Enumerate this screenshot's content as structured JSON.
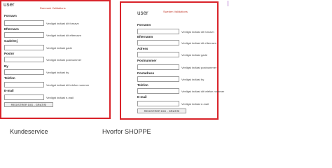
{
  "panels": {
    "dk": {
      "title": "user",
      "note": "Danmark Validations",
      "fields": [
        {
          "label": "Fornavn",
          "hint": "Venligst indtast dit fornavn"
        },
        {
          "label": "Efternavn",
          "hint": "Venligst indtast dit efternavn"
        },
        {
          "label": "Gade/Vej",
          "hint": "Venligst indtast gade"
        },
        {
          "label": "Postnr",
          "hint": "Venligst indtast postnummer"
        },
        {
          "label": "By",
          "hint": "Venligst indtast by"
        },
        {
          "label": "Telefon",
          "hint": "Venligst indtast dit telefon nummer"
        },
        {
          "label": "E-mail",
          "hint": "Venligst indtast e-mail"
        }
      ],
      "submit_label": "REGISTRER DIG - GRATIS!"
    },
    "se": {
      "title": "user",
      "note": "Sweden Validations",
      "fields": [
        {
          "label": "Fornamn",
          "hint": "Venligst indtast dit fornavn"
        },
        {
          "label": "Efternamn",
          "hint": "Venligst indtast dit efternavn"
        },
        {
          "label": "Adress",
          "hint": "Venligst indtast gade"
        },
        {
          "label": "Postnummer",
          "hint": "Venligst indtast postnummer"
        },
        {
          "label": "Postadress",
          "hint": "Venligst indtast by"
        },
        {
          "label": "Telefon",
          "hint": "Venligst indtast dit telefon nummer"
        },
        {
          "label": "E-mail",
          "hint": "Venligst indtast e-mail"
        }
      ],
      "submit_label": "REGISTRER DIG - GRATIS!"
    }
  },
  "footer": {
    "left_text": "Kundeservice",
    "right_text": "Hvorfor SHOPPE"
  },
  "colors": {
    "panel_border": "#d9232a",
    "note_text": "#c0392b"
  }
}
